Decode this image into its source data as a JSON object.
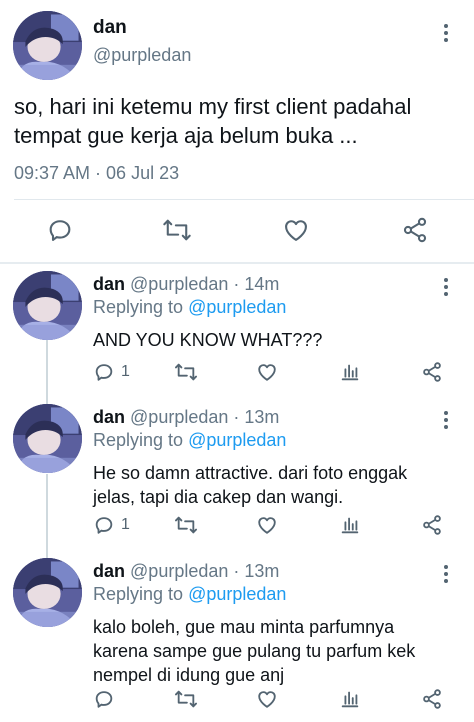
{
  "main_tweet": {
    "name": "dan",
    "handle": "@purpledan",
    "text": "so, hari ini ketemu my first client padahal tempat gue kerja aja belum buka ...",
    "timestamp": "09:37 AM · 06 Jul 23",
    "actions": [
      "reply-icon",
      "retweet-icon",
      "like-icon",
      "share-icon"
    ]
  },
  "replies": [
    {
      "name": "dan",
      "handle_time": "@purpledan · 14m",
      "replying_prefix": "Replying to",
      "replying_to": "@purpledan",
      "text": "AND YOU KNOW WHAT???",
      "reply_count": "1"
    },
    {
      "name": "dan",
      "handle_time": "@purpledan · 13m",
      "replying_prefix": "Replying to",
      "replying_to": "@purpledan",
      "text": "He so damn attractive. dari foto enggak jelas, tapi dia cakep dan wangi.",
      "reply_count": "1"
    },
    {
      "name": "dan",
      "handle_time": "@purpledan · 13m",
      "replying_prefix": "Replying to",
      "replying_to": "@purpledan",
      "text": "kalo boleh, gue mau minta parfumnya karena sampe gue pulang tu parfum kek nempel di idung gue anj",
      "reply_count": ""
    }
  ],
  "colors": {
    "accent": "#1d9bf0",
    "text": "#0f1419",
    "secondary": "#657786",
    "icon": "#536471",
    "divider": "#e1e8ed"
  }
}
